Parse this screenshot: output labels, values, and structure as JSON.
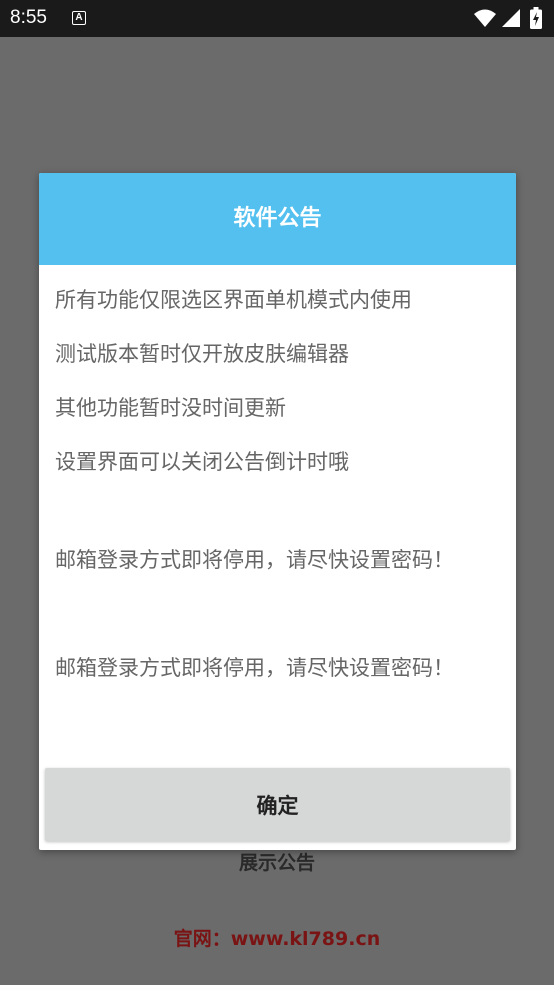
{
  "status_bar": {
    "time": "8:55",
    "notification_icon": "a-icon",
    "a_glyph": "A",
    "icons": [
      "wifi-icon",
      "signal-icon",
      "battery-icon"
    ]
  },
  "background": {
    "show_notice_label": "展示公告",
    "website_text": "官网：www.kl789.cn"
  },
  "dialog": {
    "title": "软件公告",
    "lines": [
      "所有功能仅限选区界面单机模式内使用",
      "测试版本暂时仅开放皮肤编辑器",
      "其他功能暂时没时间更新",
      "设置界面可以关闭公告倒计时哦",
      "",
      "邮箱登录方式即将停用，请尽快设置密码！",
      "邮箱登录方式即将停用，请尽快设置密码！"
    ],
    "confirm_label": "确定"
  },
  "colors": {
    "header_bg": "#53c0ef",
    "overlay_bg": "#6b6b6b",
    "body_text": "#666666",
    "website_text": "#7a1414",
    "button_bg": "#d6d7d7"
  }
}
